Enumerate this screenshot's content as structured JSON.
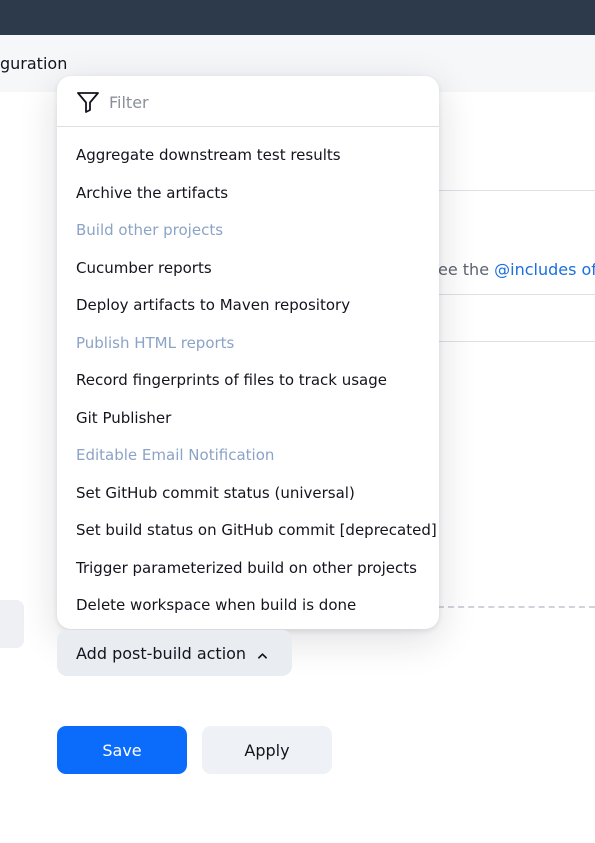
{
  "breadcrumb": {
    "current": "guration"
  },
  "background": {
    "hint_prefix": "ee the ",
    "hint_link": "@includes of A"
  },
  "filter": {
    "placeholder": "Filter",
    "icon": "filter-icon"
  },
  "menu_items": [
    {
      "label": "Aggregate downstream test results",
      "disabled": false
    },
    {
      "label": "Archive the artifacts",
      "disabled": false
    },
    {
      "label": "Build other projects",
      "disabled": true
    },
    {
      "label": "Cucumber reports",
      "disabled": false
    },
    {
      "label": "Deploy artifacts to Maven repository",
      "disabled": false
    },
    {
      "label": "Publish HTML reports",
      "disabled": true
    },
    {
      "label": "Record fingerprints of files to track usage",
      "disabled": false
    },
    {
      "label": "Git Publisher",
      "disabled": false
    },
    {
      "label": "Editable Email Notification",
      "disabled": true
    },
    {
      "label": "Set GitHub commit status (universal)",
      "disabled": false
    },
    {
      "label": "Set build status on GitHub commit [deprecated]",
      "disabled": false
    },
    {
      "label": "Trigger parameterized build on other projects",
      "disabled": false
    },
    {
      "label": "Delete workspace when build is done",
      "disabled": false
    }
  ],
  "add_action": {
    "label": "Add post-build action",
    "icon": "chevron-up-icon"
  },
  "buttons": {
    "save": "Save",
    "apply": "Apply"
  },
  "colors": {
    "topbar": "#2d3a4b",
    "primary": "#0b6cfb",
    "link": "#1a6fe0",
    "disabled_item": "#8ba3c7"
  }
}
